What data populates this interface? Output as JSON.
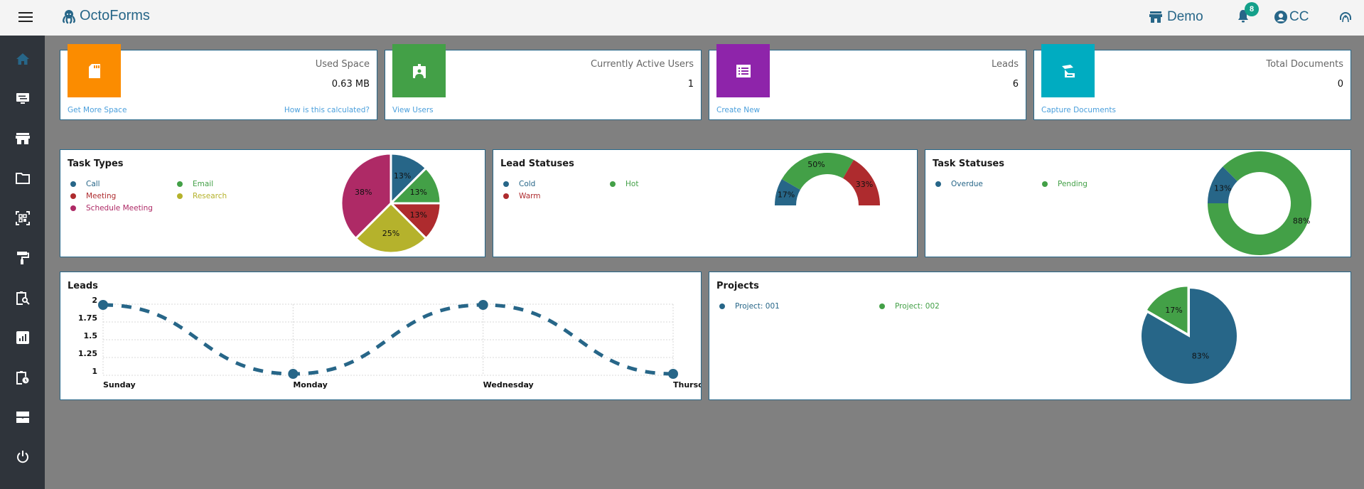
{
  "header": {
    "app_name": "OctoForms",
    "workspace": "Demo",
    "notification_count": "8",
    "user_initials": "CC",
    "brand_color": "#276688"
  },
  "sidebar": {
    "items": [
      {
        "icon": "home-icon",
        "active": true
      },
      {
        "icon": "forms-settings-icon",
        "active": false
      },
      {
        "icon": "store-icon",
        "active": false
      },
      {
        "icon": "folder-icon",
        "active": false
      },
      {
        "icon": "qr-code-scan-icon",
        "active": false
      },
      {
        "icon": "paint-roller-icon",
        "active": false
      },
      {
        "icon": "clipboard-search-icon",
        "active": false
      },
      {
        "icon": "report-chart-icon",
        "active": false
      },
      {
        "icon": "clipboard-clock-icon",
        "active": false
      },
      {
        "icon": "inbox-tray-icon",
        "active": false
      },
      {
        "icon": "power-icon",
        "active": false
      }
    ]
  },
  "stats": [
    {
      "title": "Used Space",
      "value": "0.63 MB",
      "color": "#fb8c00",
      "icon": "sd-card-icon",
      "link_left": "Get More Space",
      "link_right": "How is this calculated?"
    },
    {
      "title": "Currently Active Users",
      "value": "1",
      "color": "#43a047",
      "icon": "badge-user-icon",
      "link_left": "View Users"
    },
    {
      "title": "Leads",
      "value": "6",
      "color": "#8e24aa",
      "icon": "list-form-icon",
      "link_left": "Create New"
    },
    {
      "title": "Total Documents",
      "value": "0",
      "color": "#00acc1",
      "icon": "scanner-icon",
      "link_left": "Capture Documents"
    }
  ],
  "chart_data": [
    {
      "id": "task_types",
      "type": "pie",
      "title": "Task Types",
      "categories": [
        "Call",
        "Email",
        "Meeting",
        "Research",
        "Schedule Meeting"
      ],
      "values": [
        1,
        1,
        1,
        2,
        3
      ],
      "labels": [
        "13%",
        "13%",
        "13%",
        "25%",
        "38%"
      ],
      "colors": [
        "#276688",
        "#43a047",
        "#ae2b2e",
        "#b5b22c",
        "#ae2a66"
      ],
      "legend": [
        {
          "label": "Call",
          "color": "#276688"
        },
        {
          "label": "Email",
          "color": "#43a047"
        },
        {
          "label": "Meeting",
          "color": "#ae2b2e"
        },
        {
          "label": "Research",
          "color": "#b5b22c"
        },
        {
          "label": "Schedule Meeting",
          "color": "#ae2a66"
        }
      ],
      "legend_position": "top-left"
    },
    {
      "id": "lead_statuses",
      "type": "pie",
      "variant": "semi-donut",
      "title": "Lead Statuses",
      "categories": [
        "Cold",
        "Hot",
        "Warm"
      ],
      "values": [
        1,
        3,
        2
      ],
      "labels": [
        "17%",
        "50%",
        "33%"
      ],
      "colors": [
        "#276688",
        "#43a047",
        "#ae2b2e"
      ],
      "legend": [
        {
          "label": "Cold",
          "color": "#276688"
        },
        {
          "label": "Hot",
          "color": "#43a047"
        },
        {
          "label": "Warm",
          "color": "#ae2b2e"
        }
      ],
      "legend_position": "top-left"
    },
    {
      "id": "task_statuses",
      "type": "pie",
      "variant": "donut",
      "title": "Task Statuses",
      "categories": [
        "Overdue",
        "Pending"
      ],
      "values": [
        1,
        7
      ],
      "labels": [
        "13%",
        "88%"
      ],
      "colors": [
        "#276688",
        "#43a047"
      ],
      "legend": [
        {
          "label": "Overdue",
          "color": "#276688"
        },
        {
          "label": "Pending",
          "color": "#43a047"
        }
      ],
      "legend_position": "top-left"
    },
    {
      "id": "leads",
      "type": "line",
      "title": "Leads",
      "categories": [
        "Sunday",
        "Monday",
        "Wednesday",
        "Thursday"
      ],
      "x_tick_labels": [
        "Sunday",
        "Monday",
        "Wednesday",
        "Thursd"
      ],
      "values": [
        2,
        1,
        2,
        1
      ],
      "y_ticks": [
        "1",
        "1.25",
        "1.5",
        "1.75",
        "2"
      ],
      "ylim": [
        1,
        2
      ],
      "grid": true,
      "line_style": "dashed",
      "color": "#276688"
    },
    {
      "id": "projects",
      "type": "pie",
      "title": "Projects",
      "categories": [
        "Project: 001",
        "Project: 002"
      ],
      "values": [
        5,
        1
      ],
      "labels": [
        "83%",
        "17%"
      ],
      "colors": [
        "#276688",
        "#43a047"
      ],
      "legend": [
        {
          "label": "Project: 001",
          "color": "#276688"
        },
        {
          "label": "Project: 002",
          "color": "#43a047"
        }
      ],
      "legend_position": "top-left"
    }
  ]
}
